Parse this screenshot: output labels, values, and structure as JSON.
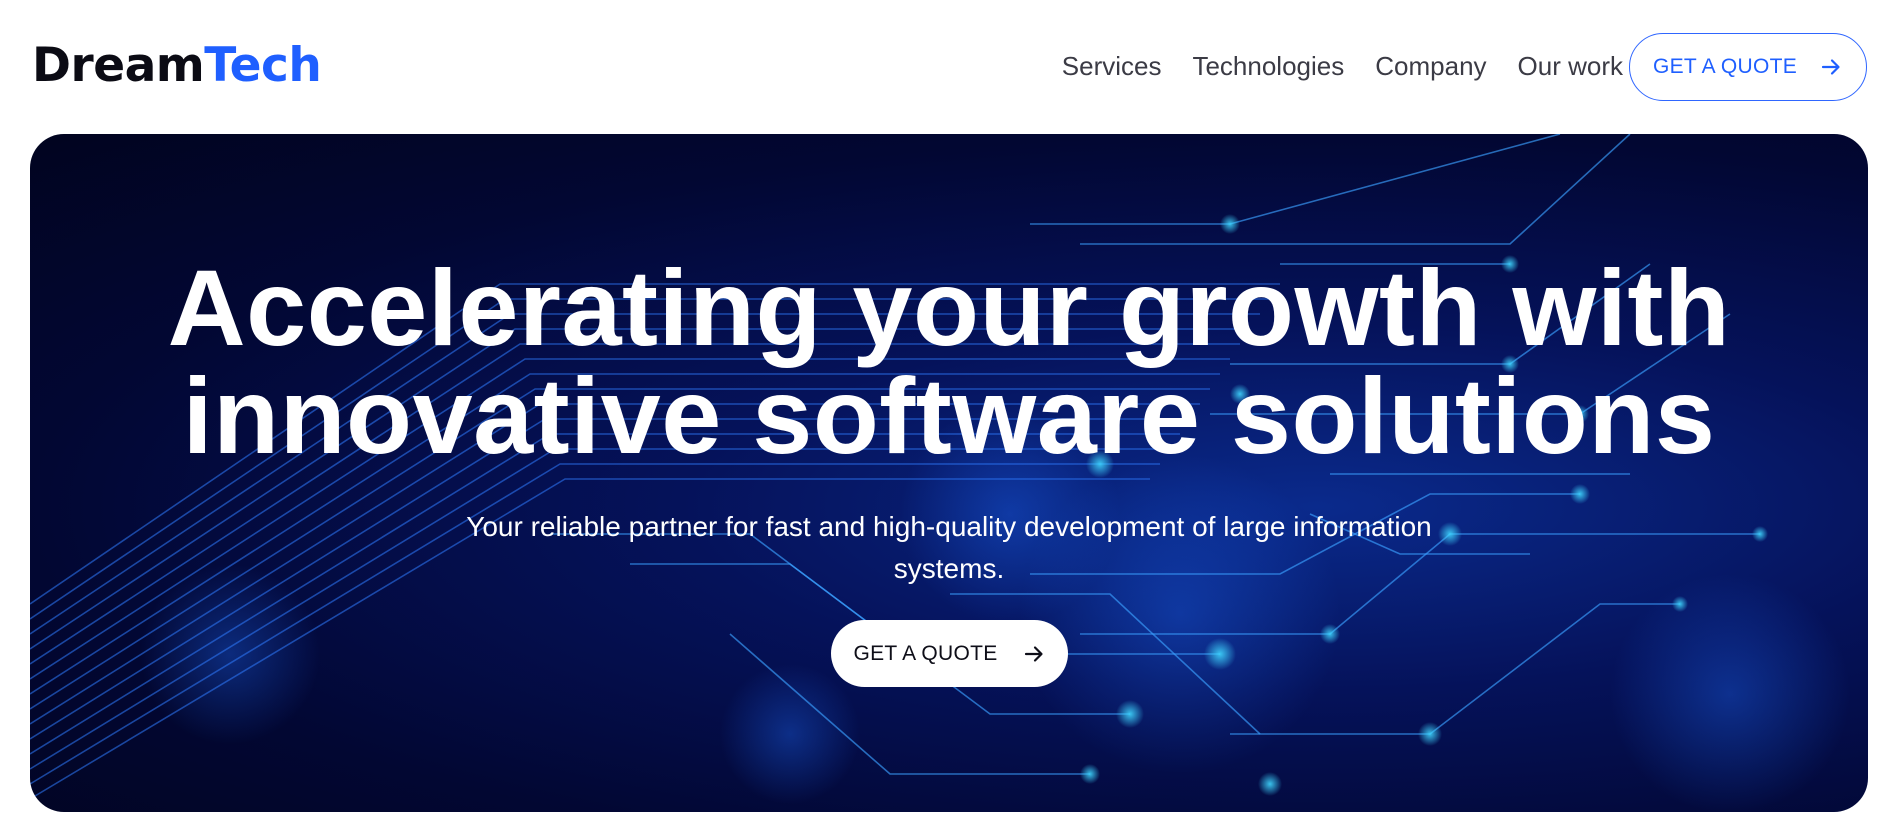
{
  "logo": {
    "part1": "Dream",
    "part2": "Tech"
  },
  "nav": {
    "items": [
      {
        "label": "Services"
      },
      {
        "label": "Technologies"
      },
      {
        "label": "Company"
      },
      {
        "label": "Our work"
      }
    ],
    "cta_label": "GET A QUOTE",
    "cta_icon": "arrow-right-icon"
  },
  "hero": {
    "title_line1": "Accelerating your growth with",
    "title_line2": "innovative software solutions",
    "subtitle": "Your reliable partner for fast and high-quality development of large information systems.",
    "cta_label": "GET A QUOTE",
    "cta_icon": "arrow-right-icon",
    "background": "circuit-board-image"
  },
  "colors": {
    "brand_blue": "#1f5fff",
    "logo_dark": "#0b0b14",
    "nav_text": "#3b3b45",
    "hero_bg_dark": "#01041f",
    "hero_bg_mid": "#0a2a8c"
  }
}
